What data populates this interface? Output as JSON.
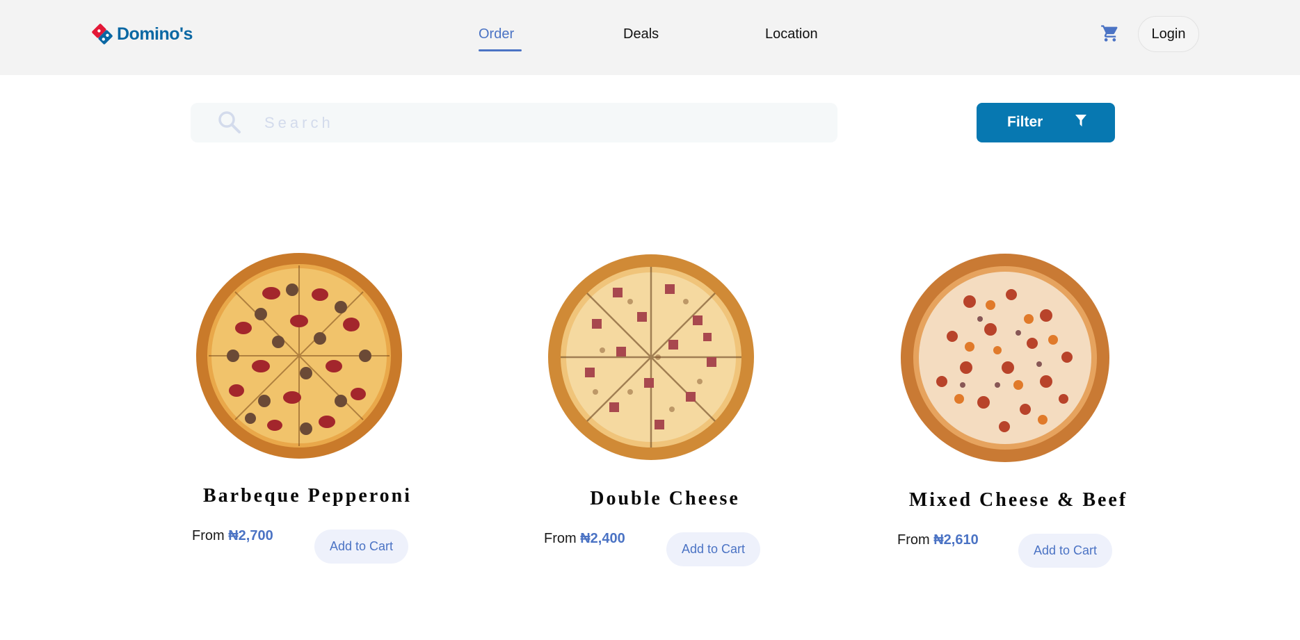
{
  "header": {
    "logo_text": "Domino's",
    "nav": [
      {
        "label": "Order",
        "active": true
      },
      {
        "label": "Deals",
        "active": false
      },
      {
        "label": "Location",
        "active": false
      }
    ],
    "cart_icon": "cart-icon",
    "login_label": "Login"
  },
  "search": {
    "placeholder": "Search",
    "value": "",
    "icon": "search-icon"
  },
  "filter": {
    "label": "Filter",
    "icon": "filter-funnel-icon"
  },
  "products": [
    {
      "name": "Barbeque Pepperoni",
      "price_prefix": "From",
      "price": "₦2,700",
      "button": "Add to Cart",
      "topping": "pepperoni-sausage"
    },
    {
      "name": "Double Cheese",
      "price_prefix": "From",
      "price": "₦2,400",
      "button": "Add to Cart",
      "topping": "ham-cubes"
    },
    {
      "name": "Mixed Cheese & Beef",
      "price_prefix": "From",
      "price": "₦2,610",
      "button": "Add to Cart",
      "topping": "mixed-cheese-beef"
    }
  ],
  "colors": {
    "accent": "#4b73c4",
    "brand_blue": "#0778b1",
    "header_bg": "#f3f3f3",
    "domino_red": "#e31837"
  }
}
